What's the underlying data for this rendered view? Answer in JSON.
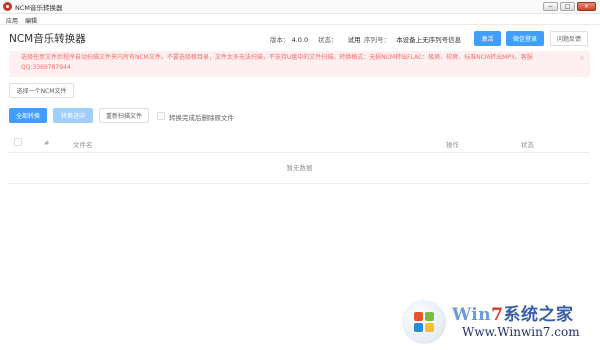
{
  "window": {
    "title": "NCM音乐转换器",
    "controls": {
      "minimize": "−",
      "maximize": "□",
      "close": "×"
    }
  },
  "menu": [
    "应用",
    "编辑"
  ],
  "header": {
    "app_title": "NCM音乐转换器",
    "version_label": "版本：",
    "version_value": "4.0.0",
    "status_label": "状态：",
    "status_value": "试用",
    "serial_label": "序列号：",
    "serial_value": "本设备上无序列号信息",
    "buttons": {
      "activate": "激活",
      "wechat_login": "微信登录",
      "feedback": "问题反馈"
    }
  },
  "alert": {
    "line1": "选择任意文件后程序自动扫描文件夹内所有NCM文件。不要选择根目录，文件太多无法扫描，不支持U盘中的文件扫描。转换格式：无损NCM转出FLAC：极爽、较爽、标准NCM转出MP3。客服",
    "line2": "QQ:3369787944",
    "close_icon": "×"
  },
  "toolbar": {
    "select_file": "选择一个NCM文件",
    "convert_all": "全部转换",
    "converting": "转换进中",
    "rescan": "重新扫描文件",
    "delete_after_label": "转换完成后删除原文件"
  },
  "table": {
    "columns": {
      "index": "#",
      "filename": "文件名",
      "action": "操作",
      "status": "状态"
    },
    "empty_text": "暂无数据"
  },
  "watermark": {
    "brand_a": "Win",
    "brand_b": "7",
    "brand_c": "系统之家",
    "url": "Www.Winwin7.com"
  },
  "colors": {
    "primary": "#409eff",
    "primary_disabled": "#a0cfff",
    "alert_bg": "#fef0f0",
    "alert_text": "#f56c6c"
  }
}
